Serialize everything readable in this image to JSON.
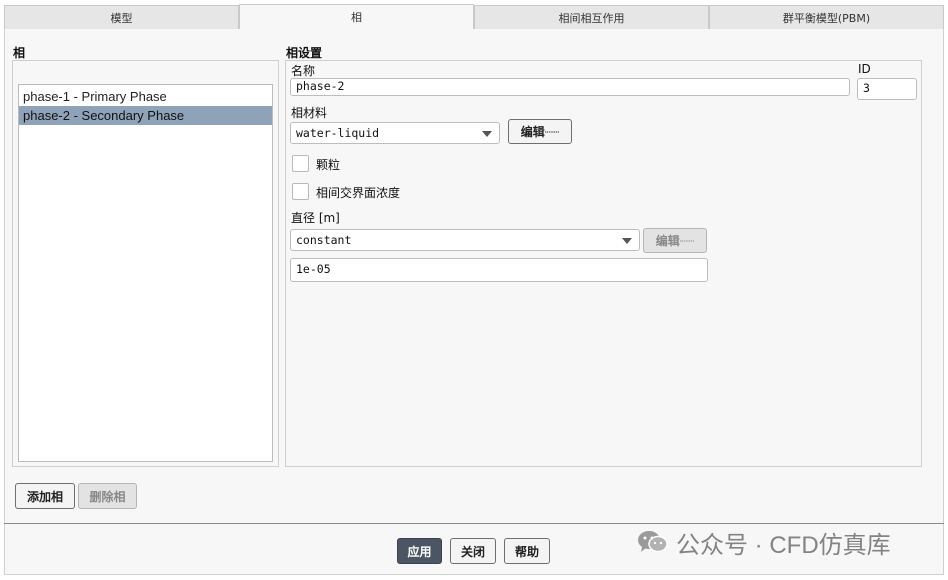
{
  "tabs": [
    {
      "label": "模型",
      "active": false
    },
    {
      "label": "相",
      "active": true
    },
    {
      "label": "相间相互作用",
      "active": false
    },
    {
      "label": "群平衡模型(PBM)",
      "active": false
    }
  ],
  "phases_panel": {
    "title": "相",
    "items": [
      {
        "label": "phase-1 - Primary Phase",
        "selected": false
      },
      {
        "label": "phase-2 - Secondary Phase",
        "selected": true
      }
    ],
    "add_button": "添加相",
    "delete_button": "删除相"
  },
  "settings": {
    "title": "相设置",
    "name_label": "名称",
    "name_value": "phase-2",
    "id_label": "ID",
    "id_value": "3",
    "material_label": "相材料",
    "material_value": "water-liquid",
    "material_edit_button": "编辑┈┈",
    "particle_label": "颗粒",
    "interfacial_label": "相间交界面浓度",
    "diameter_label": "直径 [m]",
    "diameter_method": "constant",
    "diameter_edit_button": "编辑┈┈",
    "diameter_value": "1e-05"
  },
  "footer": {
    "apply": "应用",
    "close": "关闭",
    "help": "帮助"
  },
  "watermark": "公众号 · CFD仿真库",
  "colors": {
    "selection": "#8fa3b8",
    "primary_button": "#4b5563"
  }
}
